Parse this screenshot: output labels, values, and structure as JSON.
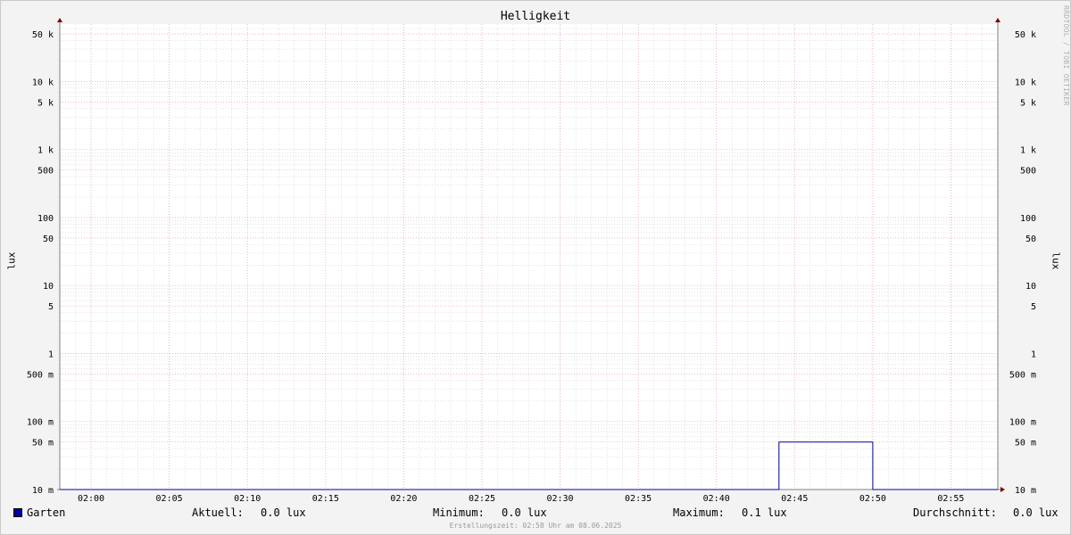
{
  "title": "Helligkeit",
  "watermark": "RRDTOOL / TOBI OETIKER",
  "colors": {
    "background": "#f3f3f3",
    "plot_background": "#ffffff",
    "major_grid": "#e8a0a0",
    "minor_grid": "#c8c8c8",
    "axis": "#808080",
    "series": "#0000a0",
    "arrow": "#800000"
  },
  "legend": {
    "series_name": "Garten",
    "current_label": "Aktuell:",
    "current_value": "0.0 lux",
    "min_label": "Minimum:",
    "min_value": "0.0 lux",
    "max_label": "Maximum:",
    "max_value": "0.1 lux",
    "avg_label": "Durchschnitt:",
    "avg_value": "0.0 lux"
  },
  "footer": "Erstellungszeit: 02:58 Uhr am 08.06.2025",
  "chart_data": {
    "type": "line",
    "title": "Helligkeit",
    "ylabel": "lux",
    "yscale": "log",
    "ylim": [
      0.01,
      70000
    ],
    "xlim": [
      "01:58",
      "02:58"
    ],
    "x_ticks": [
      "02:00",
      "02:05",
      "02:10",
      "02:15",
      "02:20",
      "02:25",
      "02:30",
      "02:35",
      "02:40",
      "02:45",
      "02:50",
      "02:55"
    ],
    "y_ticks": [
      {
        "value": 0.01,
        "label": "10 m"
      },
      {
        "value": 0.05,
        "label": "50 m"
      },
      {
        "value": 0.1,
        "label": "100 m"
      },
      {
        "value": 0.5,
        "label": "500 m"
      },
      {
        "value": 1,
        "label": "1"
      },
      {
        "value": 5,
        "label": "5"
      },
      {
        "value": 10,
        "label": "10"
      },
      {
        "value": 50,
        "label": "50"
      },
      {
        "value": 100,
        "label": "100"
      },
      {
        "value": 500,
        "label": "500"
      },
      {
        "value": 1000,
        "label": "1 k"
      },
      {
        "value": 5000,
        "label": "5 k"
      },
      {
        "value": 10000,
        "label": "10 k"
      },
      {
        "value": 50000,
        "label": "50 k"
      }
    ],
    "grid": true,
    "legend_position": "bottom",
    "series": [
      {
        "name": "Garten",
        "color": "#0000a0",
        "x": [
          "01:58",
          "02:44",
          "02:44",
          "02:50",
          "02:50",
          "02:58"
        ],
        "y": [
          0.01,
          0.01,
          0.05,
          0.05,
          0.01,
          0.01
        ]
      }
    ]
  }
}
